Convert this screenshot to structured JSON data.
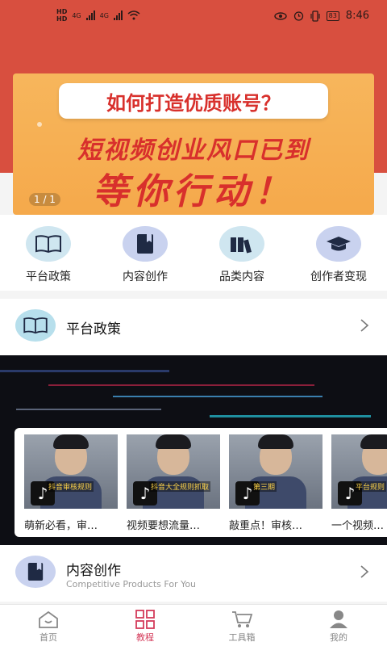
{
  "status_bar": {
    "time": "8:46",
    "battery": "83",
    "network_a": "4G",
    "network_b": "4G"
  },
  "banner": {
    "headline": "如何打造优质账号？",
    "line1": "短视频创业风口已到",
    "line2": "等你行动！",
    "pager": "1 / 1"
  },
  "quick_nav": [
    {
      "label": "平台政策",
      "icon": "book-icon"
    },
    {
      "label": "内容创作",
      "icon": "notebook-icon"
    },
    {
      "label": "品类内容",
      "icon": "books-icon"
    },
    {
      "label": "创作者变现",
      "icon": "graduation-cap-icon"
    }
  ],
  "section_policy": {
    "title": "平台政策",
    "icon": "book-icon"
  },
  "videos": [
    {
      "title": "萌新必看，审…",
      "caption": "抖音审核规则"
    },
    {
      "title": "视频要想流量…",
      "caption": "抖音大全规则抓取"
    },
    {
      "title": "敲重点！审核…",
      "caption": "第三期"
    },
    {
      "title": "一个视频…",
      "caption": "平台规则"
    }
  ],
  "section_content": {
    "title": "内容创作",
    "subtitle": "Competitive Products For You",
    "icon": "notebook-icon"
  },
  "tabbar": [
    {
      "label": "首页",
      "icon": "home-icon",
      "active": false
    },
    {
      "label": "教程",
      "icon": "grid-icon",
      "active": true
    },
    {
      "label": "工具箱",
      "icon": "cart-icon",
      "active": false
    },
    {
      "label": "我的",
      "icon": "user-icon",
      "active": false
    }
  ],
  "colors": {
    "header": "#d84f3f",
    "banner": "#f5a94b",
    "accent": "#d43a5a",
    "banner_text": "#d8302c"
  }
}
